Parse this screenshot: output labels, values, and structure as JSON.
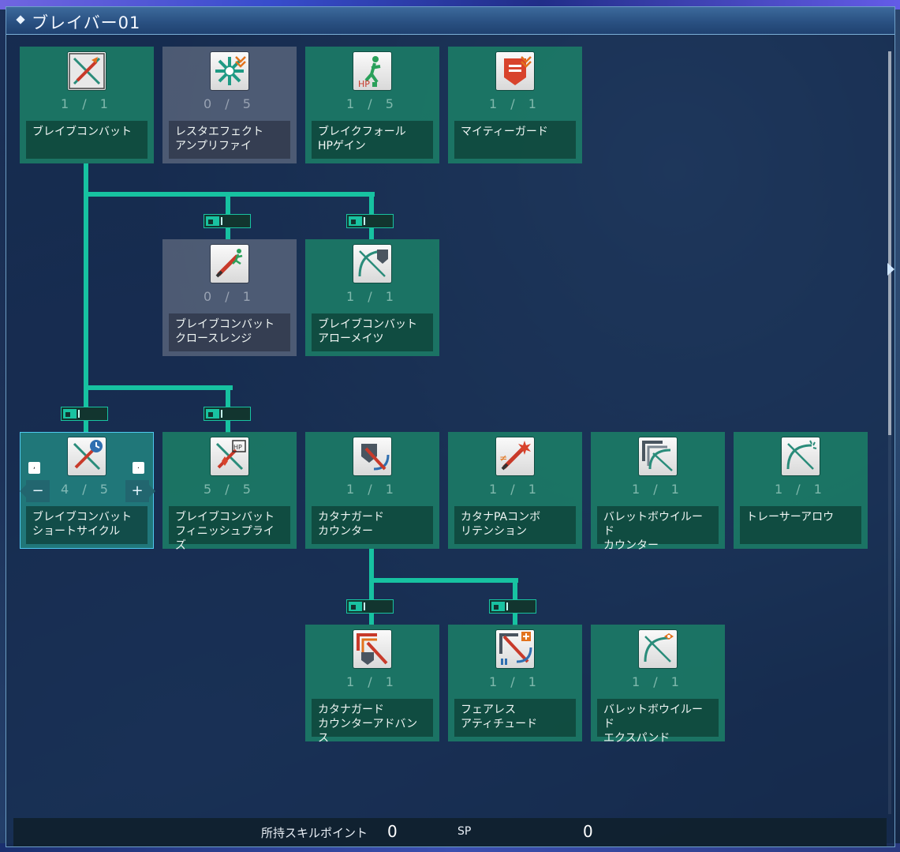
{
  "window": {
    "title": "ブレイバー01"
  },
  "colors": {
    "accent": "#17c2a1",
    "node_learned": "#1c8268",
    "node_locked": "#5c687e",
    "title_bar": "#2a5182"
  },
  "nodes": {
    "brave_combat": {
      "name": "ブレイブコンバット",
      "level": "1 / 1",
      "icon": "brave-combat-icon"
    },
    "resta_effect": {
      "name": "レスタエフェクト\nアンプリファイ",
      "level": "0 / 5",
      "icon": "resta-effect-icon"
    },
    "break_fall": {
      "name": "ブレイクフォール\nHPゲイン",
      "level": "1 / 5",
      "icon": "break-fall-hp-icon"
    },
    "mighty_guard": {
      "name": "マイティーガード",
      "level": "1 / 1",
      "icon": "mighty-guard-icon"
    },
    "close_range": {
      "name": "ブレイブコンバット\nクロースレンジ",
      "level": "0 / 1",
      "icon": "katana-run-icon"
    },
    "arrow_mates": {
      "name": "ブレイブコンバット\nアローメイツ",
      "level": "1 / 1",
      "icon": "bow-shield-icon"
    },
    "short_cycle": {
      "name": "ブレイブコンバット\nショートサイクル",
      "level": "4 / 5",
      "icon": "short-cycle-icon",
      "minus": "−",
      "plus": "+",
      "key_left": ",",
      "key_right": "."
    },
    "finish_prize": {
      "name": "ブレイブコンバット\nフィニッシュプライズ",
      "level": "5 / 5",
      "icon": "finish-prize-icon"
    },
    "katana_guard": {
      "name": "カタナガード\nカウンター",
      "level": "1 / 1",
      "icon": "katana-guard-icon"
    },
    "katana_pa": {
      "name": "カタナPAコンボ\nリテンション",
      "level": "1 / 1",
      "icon": "katana-pa-icon"
    },
    "bullet_bow_counter": {
      "name": "バレットボウイルード\nカウンター",
      "level": "1 / 1",
      "icon": "bow-counter-icon"
    },
    "tracer_arrow": {
      "name": "トレーサーアロウ",
      "level": "1 / 1",
      "icon": "tracer-arrow-icon"
    },
    "katana_guard_adv": {
      "name": "カタナガード\nカウンターアドバンス",
      "level": "1 / 1",
      "icon": "katana-guard-advance-icon"
    },
    "fearless": {
      "name": "フェアレス\nアティチュード",
      "level": "1 / 1",
      "icon": "fearless-icon"
    },
    "bullet_bow_expand": {
      "name": "バレットボウイルード\nエクスパンド",
      "level": "1 / 1",
      "icon": "bow-expand-icon"
    }
  },
  "footer": {
    "skill_points_label": "所持スキルポイント",
    "skill_points_value": "0",
    "sp_label": "SP",
    "sp_value": "0"
  }
}
